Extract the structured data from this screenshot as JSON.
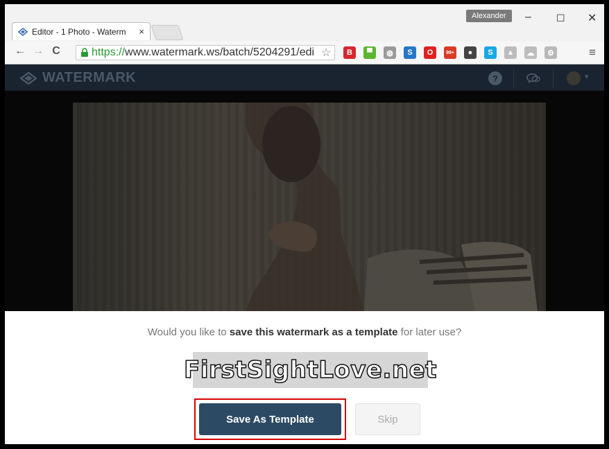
{
  "browser": {
    "tab_title": "Editor - 1 Photo - Waterm",
    "tab_close": "×",
    "profile_name": "Alexander",
    "window_controls": {
      "minimize": "–",
      "maximize": "☐",
      "close": "✕"
    },
    "nav": {
      "back": "←",
      "forward": "→",
      "reload": "C"
    },
    "url_scheme": "https://",
    "url_rest": "www.watermark.ws/batch/5204291/edi",
    "star": "☆",
    "menu": "≡",
    "extensions": [
      {
        "name": "b-extension-icon",
        "glyph": "B",
        "color": "#d8262e"
      },
      {
        "name": "green-robot-icon",
        "glyph": "▀",
        "color": "#5db52f"
      },
      {
        "name": "globe-icon",
        "glyph": "◍",
        "color": "#9a9a9a"
      },
      {
        "name": "s-extension-icon",
        "glyph": "S",
        "color": "#2577c9"
      },
      {
        "name": "opera-badge-icon",
        "glyph": "O",
        "color": "#e0201f"
      },
      {
        "name": "red-badge-99-icon",
        "glyph": "99+",
        "color": "#d93a26"
      },
      {
        "name": "dark-globe-icon",
        "glyph": "●",
        "color": "#444"
      },
      {
        "name": "skype-icon",
        "glyph": "S",
        "color": "#19a8e6"
      },
      {
        "name": "drive-icon",
        "glyph": "▲",
        "color": "#bcbcbc"
      },
      {
        "name": "cloud-icon",
        "glyph": "☁",
        "color": "#bdbdbd"
      },
      {
        "name": "settings-ext-icon",
        "glyph": "⚙",
        "color": "#b8b8b8"
      }
    ]
  },
  "app": {
    "logo_text": "WATERMARK",
    "help_icon": "?",
    "chat_icon": "chat",
    "avatar_caret": "▾"
  },
  "dialog": {
    "question_prefix": "Would you like to ",
    "question_bold": "save this watermark as a template",
    "question_suffix": " for later use?",
    "watermark_preview_text": "FirstSightLove.net",
    "save_button": "Save As Template",
    "skip_button": "Skip"
  },
  "colors": {
    "appbar": "#1a2430",
    "primary_button": "#2c4a64",
    "highlight": "#d40000"
  }
}
